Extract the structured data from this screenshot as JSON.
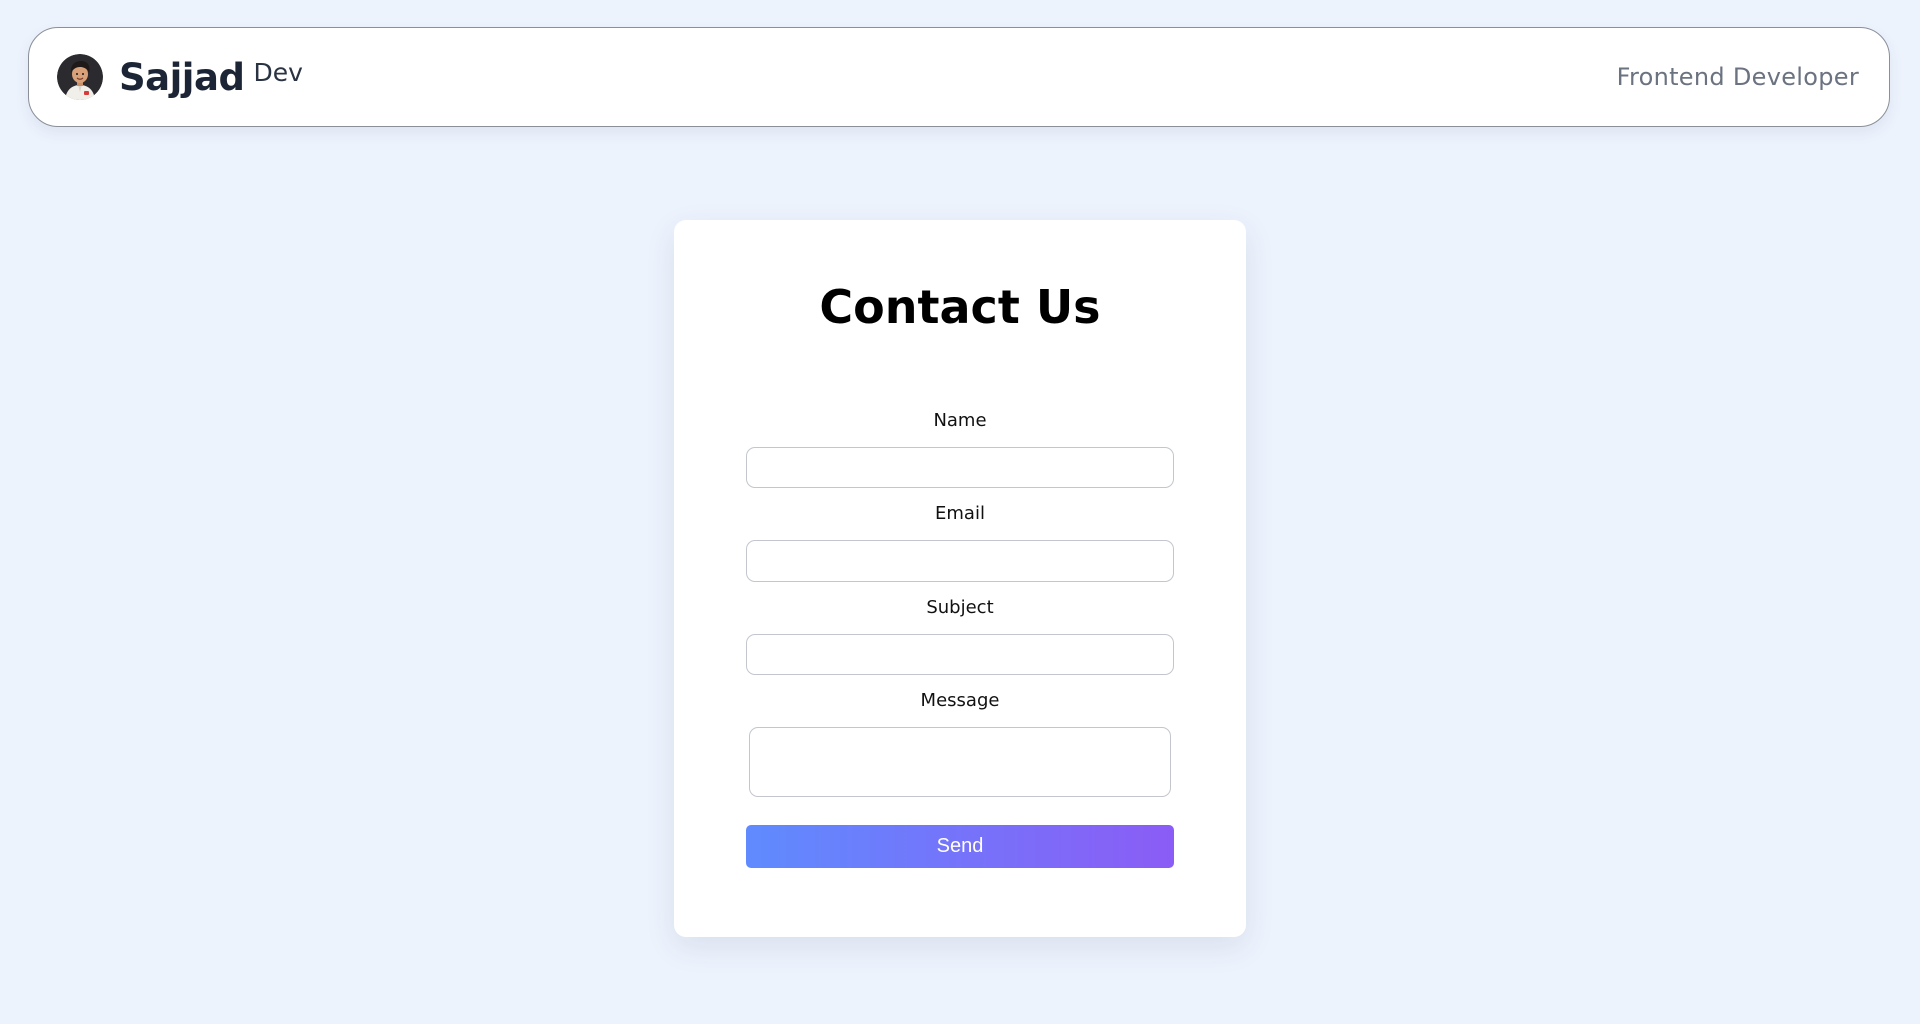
{
  "header": {
    "brand_name": "Sajjad",
    "brand_suffix": "Dev",
    "role": "Frontend Developer",
    "avatar_icon": "developer-avatar-icon"
  },
  "contact": {
    "title": "Contact Us",
    "fields": {
      "name": {
        "label": "Name",
        "value": ""
      },
      "email": {
        "label": "Email",
        "value": ""
      },
      "subject": {
        "label": "Subject",
        "value": ""
      },
      "message": {
        "label": "Message",
        "value": ""
      }
    },
    "send_label": "Send"
  },
  "colors": {
    "page_background": "#edf3fd",
    "button_gradient_start": "#5f8bfe",
    "button_gradient_end": "#8b5cf6",
    "brand_text": "#1c2535",
    "role_text": "#6b7280"
  }
}
